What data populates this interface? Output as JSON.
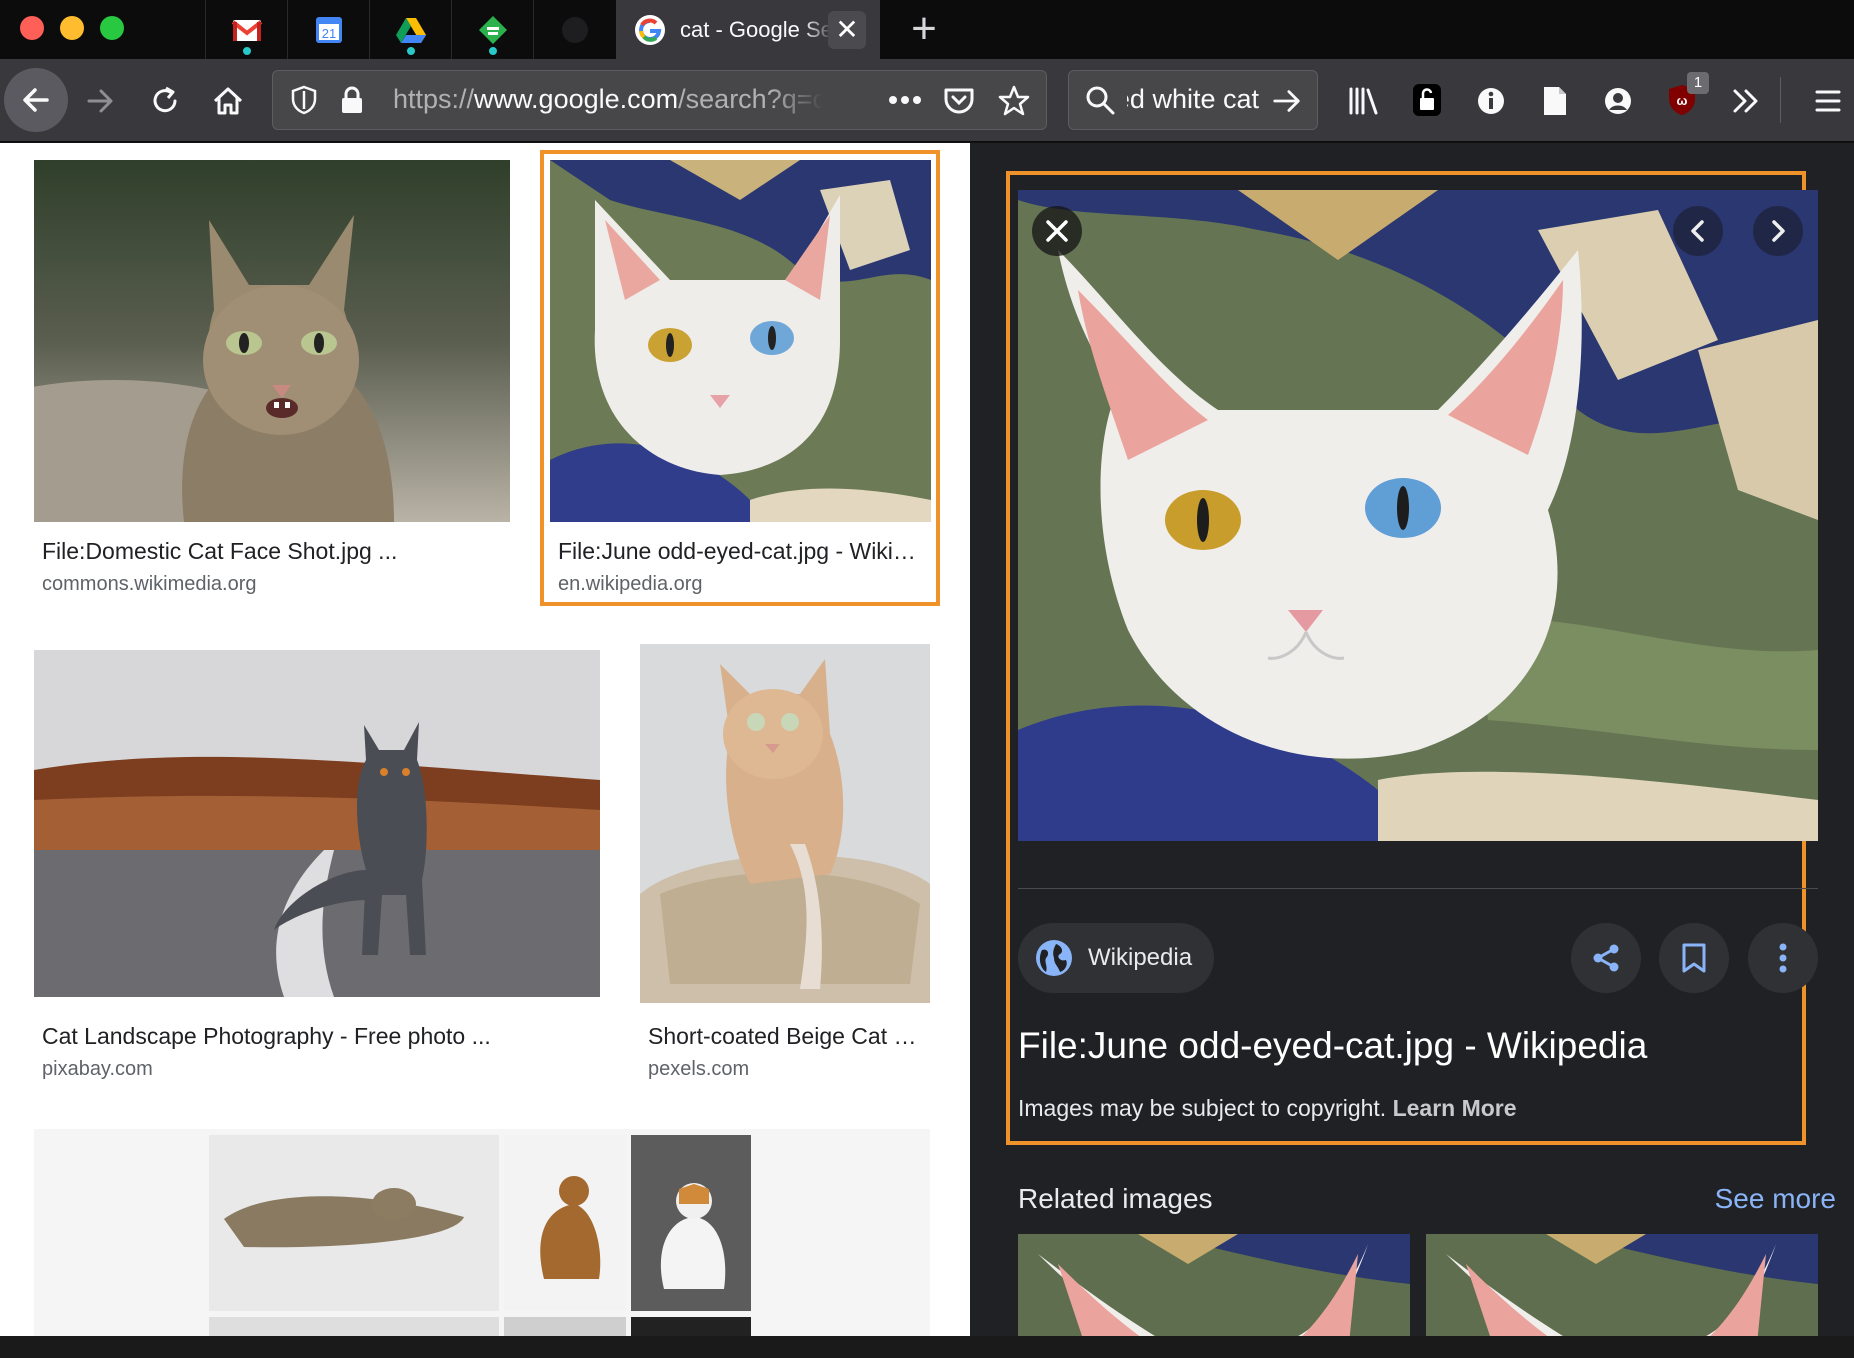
{
  "browser": {
    "active_tab": {
      "title": "cat - Google Search",
      "favicon": "google-g-icon"
    },
    "pinned_tabs": [
      "gmail-icon",
      "calendar-icon",
      "drive-icon",
      "feedly-icon",
      "github-icon"
    ],
    "calendar_day": "21",
    "url": {
      "scheme": "https://",
      "host": "www.google.com",
      "path": "/search?q=cat&tbm=isch"
    },
    "search_field": "odd-eyed white cat",
    "extension_badge": "1"
  },
  "results": [
    {
      "title": "File:Domestic Cat Face Shot.jpg ...",
      "domain": "commons.wikimedia.org"
    },
    {
      "title": "File:June odd-eyed-cat.jpg - Wikipedia",
      "domain": "en.wikipedia.org"
    },
    {
      "title": "Cat Landscape Photography - Free photo ...",
      "domain": "pixabay.com"
    },
    {
      "title": "Short-coated Beige Cat on Beige Pillow",
      "domain": "pexels.com"
    }
  ],
  "panel": {
    "source": "Wikipedia",
    "title": "File:June odd-eyed-cat.jpg - Wikipedia",
    "copyright": "Images may be subject to copyright.",
    "learn_more": "Learn More",
    "related": "Related images",
    "see_more": "See more"
  },
  "colors": {
    "selection": "#f0922a",
    "link": "#8ab4f8",
    "panel_bg": "#202124"
  }
}
